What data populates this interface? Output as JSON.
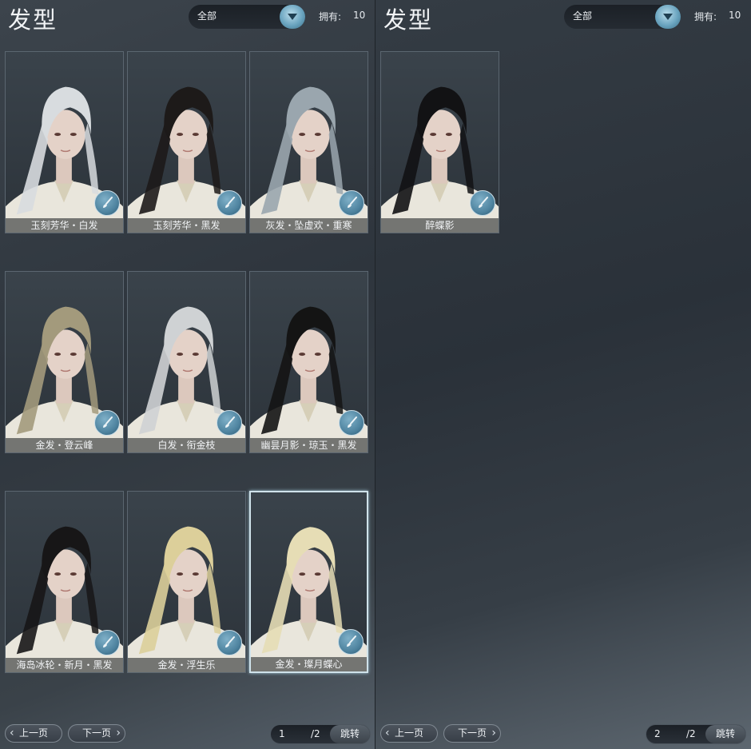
{
  "panels": [
    {
      "title": "发型",
      "filter": {
        "selected": "全部"
      },
      "owned": {
        "label": "拥有:",
        "value": "10"
      },
      "cards": [
        {
          "name": "玉刻芳华・白发",
          "hair": "#d8dcdf",
          "selected": false
        },
        {
          "name": "玉刻芳华・黑发",
          "hair": "#1d1a19",
          "selected": false
        },
        {
          "name": "灰发・坠虚欢・重寒",
          "hair": "#9aa6ae",
          "selected": false
        },
        {
          "name": "金发・登云峰",
          "hair": "#a39a7c",
          "selected": false
        },
        {
          "name": "白发・衔金枝",
          "hair": "#cfd2d4",
          "selected": false
        },
        {
          "name": "幽昙月影・琼玉・黑发",
          "hair": "#141414",
          "selected": false
        },
        {
          "name": "海岛冰轮・新月・黑发",
          "hair": "#171617",
          "selected": false
        },
        {
          "name": "金发・浮生乐",
          "hair": "#dccf9a",
          "selected": false
        },
        {
          "name": "金发・璨月蝶心",
          "hair": "#e6ddb5",
          "selected": true
        }
      ],
      "nav": {
        "prev": "上一页",
        "next": "下一页",
        "current": "1",
        "total": "/2",
        "jump": "跳转"
      }
    },
    {
      "title": "发型",
      "filter": {
        "selected": "全部"
      },
      "owned": {
        "label": "拥有:",
        "value": "10"
      },
      "cards": [
        {
          "name": "醉蝶影",
          "hair": "#121214",
          "selected": false
        }
      ],
      "nav": {
        "prev": "上一页",
        "next": "下一页",
        "current": "2",
        "total": "/2",
        "jump": "跳转"
      }
    }
  ],
  "icons": {
    "filter": "chevron-down-icon",
    "card_badge": "brush-icon",
    "prev": "chevron-left-icon",
    "next": "chevron-right-icon"
  }
}
